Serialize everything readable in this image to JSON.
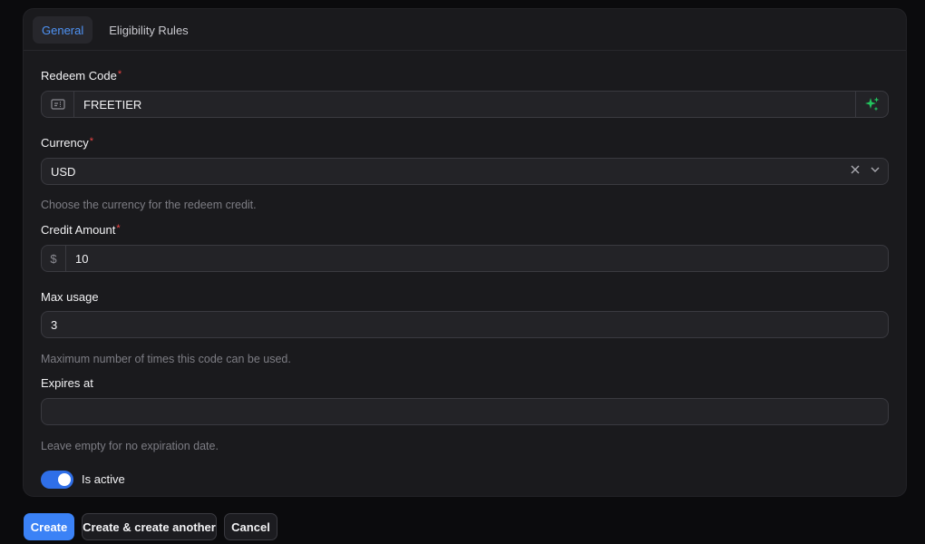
{
  "tabs": [
    {
      "label": "General",
      "active": true
    },
    {
      "label": "Eligibility Rules",
      "active": false
    }
  ],
  "form": {
    "redeem_code": {
      "label": "Redeem Code",
      "required_mark": "*",
      "value": "FREETIER",
      "prefix_icon": "ticket-icon",
      "suffix_icon": "sparkles-icon"
    },
    "currency": {
      "label": "Currency",
      "required_mark": "*",
      "value": "USD",
      "hint": "Choose the currency for the redeem credit."
    },
    "credit_amount": {
      "label": "Credit Amount",
      "required_mark": "*",
      "prefix": "$",
      "value": "10"
    },
    "max_usage": {
      "label": "Max usage",
      "value": "3",
      "hint": "Maximum number of times this code can be used."
    },
    "expires_at": {
      "label": "Expires at",
      "value": "",
      "hint": "Leave empty for no expiration date."
    },
    "is_active": {
      "label": "Is active",
      "on": true
    }
  },
  "actions": {
    "create": "Create",
    "create_another": "Create & create another",
    "cancel": "Cancel"
  },
  "colors": {
    "accent": "#3b82f6",
    "tab_active_text": "#4f93f5",
    "required": "#ef4444",
    "sparkle": "#22c55e"
  }
}
